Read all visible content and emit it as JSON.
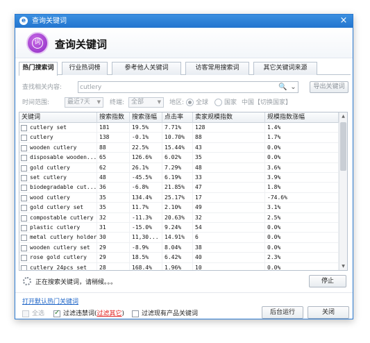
{
  "window": {
    "title": "查询关键词",
    "close_glyph": "×",
    "logo_icon": "e-logo-icon"
  },
  "header": {
    "title": "查询关键词",
    "icon_glyph": "词",
    "icon_color": "#9b3ad0"
  },
  "tabs": [
    {
      "label": "热门搜索词",
      "active": true
    },
    {
      "label": "行业热词榜",
      "active": false
    },
    {
      "label": "参考他人关键词",
      "active": false
    },
    {
      "label": "访客常用搜索词",
      "active": false
    },
    {
      "label": "其它关键词来源",
      "active": false
    }
  ],
  "search": {
    "label": "查找相关内容:",
    "value": "cutlery",
    "search_glyph": "🔍",
    "dropdown_glyph": "⌄",
    "export_label": "导出关键词"
  },
  "filter": {
    "time_label": "时间范围:",
    "time_value": "最近7天",
    "device_label": "终端:",
    "device_value": "全部",
    "region_label": "地区:",
    "global_label": "全球",
    "country_label": "国家",
    "country_value": "中国【切换国家】",
    "arrow_glyph": "▼"
  },
  "grid": {
    "columns": [
      "关键词",
      "搜索指数",
      "搜索涨幅",
      "点击率",
      "卖家规模指数",
      "规模指数涨幅"
    ],
    "rows": [
      [
        "cutlery set",
        "181",
        "19.5%",
        "7.71%",
        "128",
        "1.4%"
      ],
      [
        "cutlery",
        "138",
        "-0.1%",
        "10.70%",
        "88",
        "1.7%"
      ],
      [
        "wooden cutlery",
        "88",
        "22.5%",
        "15.44%",
        "43",
        "0.0%"
      ],
      [
        "disposable wooden...",
        "65",
        "126.6%",
        "6.02%",
        "35",
        "0.0%"
      ],
      [
        "gold cutlery",
        "62",
        "26.1%",
        "7.29%",
        "48",
        "3.6%"
      ],
      [
        "set cutlery",
        "48",
        "-45.5%",
        "6.19%",
        "33",
        "3.9%"
      ],
      [
        "biodegradable cut...",
        "36",
        "-6.8%",
        "21.85%",
        "47",
        "1.8%"
      ],
      [
        "wood cutlery",
        "35",
        "134.4%",
        "25.17%",
        "17",
        "-74.6%"
      ],
      [
        "gold cutlery set",
        "35",
        "11.7%",
        "2.10%",
        "49",
        "3.1%"
      ],
      [
        "compostable cutlery",
        "32",
        "-11.3%",
        "20.63%",
        "32",
        "2.5%"
      ],
      [
        "plastic cutlery",
        "31",
        "-15.0%",
        "9.24%",
        "54",
        "0.0%"
      ],
      [
        "metal cutlery holder",
        "30",
        "11,30...",
        "14.91%",
        "6",
        "0.0%"
      ],
      [
        "wooden cutlery set",
        "29",
        "-8.9%",
        "8.04%",
        "38",
        "0.0%"
      ],
      [
        "rose gold cutlery",
        "29",
        "18.5%",
        "6.42%",
        "40",
        "2.3%"
      ],
      [
        "cutlery 24pcs set",
        "28",
        "168.4%",
        "1.96%",
        "10",
        "0.0%"
      ]
    ]
  },
  "status": {
    "text": "正在搜索关键词，请稍候。。。",
    "stop_label": "停止"
  },
  "footer": {
    "link": "打开默认热门关键词",
    "select_all": "全选",
    "filter_banned": "过滤违禁词(",
    "filter_other": "过滤其它",
    "filter_banned_close": ")",
    "filter_existing": "过滤现有产品关键词",
    "background_label": "后台运行",
    "close_label": "关闭"
  }
}
